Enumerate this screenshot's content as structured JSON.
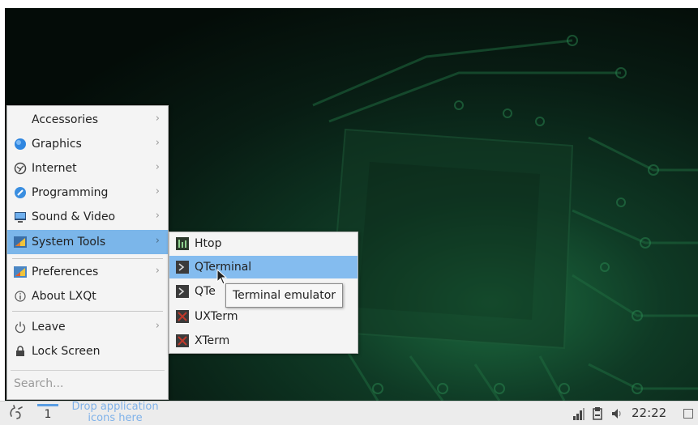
{
  "main_menu": {
    "items": [
      {
        "label": "Accessories",
        "icon": "accessories-icon",
        "has_submenu": true
      },
      {
        "label": "Graphics",
        "icon": "graphics-icon",
        "has_submenu": true
      },
      {
        "label": "Internet",
        "icon": "internet-icon",
        "has_submenu": true
      },
      {
        "label": "Programming",
        "icon": "programming-icon",
        "has_submenu": true
      },
      {
        "label": "Sound & Video",
        "icon": "sound-video-icon",
        "has_submenu": true
      },
      {
        "label": "System Tools",
        "icon": "system-tools-icon",
        "has_submenu": true,
        "active": true
      },
      {
        "label": "Preferences",
        "icon": "preferences-icon",
        "has_submenu": true
      },
      {
        "label": "About LXQt",
        "icon": "info-icon",
        "has_submenu": false
      },
      {
        "label": "Leave",
        "icon": "power-icon",
        "has_submenu": true
      },
      {
        "label": "Lock Screen",
        "icon": "lock-icon",
        "has_submenu": false
      }
    ],
    "search_placeholder": "Search..."
  },
  "system_tools_menu": {
    "items": [
      {
        "label": "Htop",
        "icon": "htop-icon"
      },
      {
        "label": "QTerminal",
        "icon": "terminal-icon",
        "active": true
      },
      {
        "label": "QTe",
        "icon": "terminal-icon"
      },
      {
        "label": "UXTerm",
        "icon": "xterm-icon"
      },
      {
        "label": "XTerm",
        "icon": "xterm-icon"
      }
    ]
  },
  "tooltip": "Terminal emulator",
  "panel": {
    "desktop_number": "1",
    "drop_hint_line1": "Drop application",
    "drop_hint_line2": "icons here",
    "clock": "22:22"
  },
  "colors": {
    "highlight": "#7bb6ea",
    "menu_bg": "#f4f4f4",
    "panel_bg": "#ececec",
    "accent": "#5b9ee3"
  }
}
